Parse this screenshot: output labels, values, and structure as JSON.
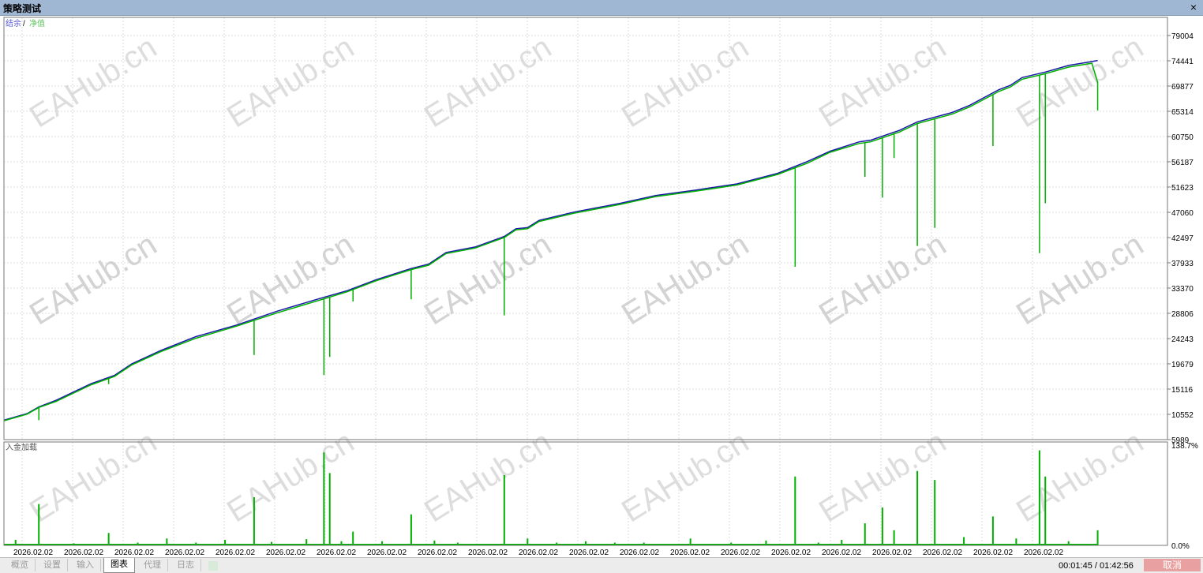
{
  "window": {
    "title": "策略测试",
    "close_label": "×"
  },
  "colors": {
    "balance": "#1a1aa6",
    "equity": "#00b000",
    "grid": "#dcdcdc",
    "watermark": "#cfcfcf",
    "axis_text": "#000000",
    "cancel_bg": "#e9a0a0"
  },
  "legend": {
    "balance": "结余",
    "separator": "/",
    "equity": "净值"
  },
  "lower_panel": {
    "title": "入金加载"
  },
  "watermark": "EAHub.cn",
  "tabs": [
    {
      "label": "概览",
      "active": false
    },
    {
      "label": "设置",
      "active": false
    },
    {
      "label": "输入",
      "active": false
    },
    {
      "label": "图表",
      "active": true
    },
    {
      "label": "代理",
      "active": false
    },
    {
      "label": "日志",
      "active": false
    }
  ],
  "status": {
    "timer": "00:01:45 / 01:42:56",
    "cancel_label": "取消"
  },
  "chart_data": [
    {
      "type": "line",
      "title": "",
      "y_ticks": [
        "79004",
        "74441",
        "69877",
        "65314",
        "60750",
        "56187",
        "51623",
        "47060",
        "42497",
        "37933",
        "33370",
        "28806",
        "24243",
        "19679",
        "15116",
        "10552",
        "5989"
      ],
      "ylim": [
        5989,
        81000
      ],
      "x_ticks": [
        "2026.02.02",
        "2026.02.02",
        "2026.02.02",
        "2026.02.02",
        "2026.02.02",
        "2026.02.02",
        "2026.02.02",
        "2026.02.02",
        "2026.02.02",
        "2026.02.02",
        "2026.02.02",
        "2026.02.02",
        "2026.02.02",
        "2026.02.02",
        "2026.02.02",
        "2026.02.02",
        "2026.02.02",
        "2026.02.02",
        "2026.02.02",
        "2026.02.02",
        "2026.02.02"
      ],
      "grid": true,
      "series": [
        {
          "name": "结余",
          "points": [
            [
              0,
              9500
            ],
            [
              4,
              10700
            ],
            [
              6,
              11900
            ],
            [
              9,
              13100
            ],
            [
              12,
              14600
            ],
            [
              15,
              16100
            ],
            [
              19,
              17600
            ],
            [
              22,
              19700
            ],
            [
              27,
              22100
            ],
            [
              33,
              24600
            ],
            [
              40,
              26700
            ],
            [
              47,
              29200
            ],
            [
              54,
              31400
            ],
            [
              59,
              32900
            ],
            [
              64,
              34900
            ],
            [
              70,
              36900
            ],
            [
              73,
              37700
            ],
            [
              76,
              39800
            ],
            [
              81,
              40800
            ],
            [
              86,
              42700
            ],
            [
              88,
              44100
            ],
            [
              90,
              44300
            ],
            [
              92,
              45600
            ],
            [
              94,
              46100
            ],
            [
              98,
              47100
            ],
            [
              106,
              48700
            ],
            [
              112,
              50100
            ],
            [
              119,
              51100
            ],
            [
              126,
              52200
            ],
            [
              133,
              54100
            ],
            [
              138,
              56200
            ],
            [
              142,
              58100
            ],
            [
              147,
              59800
            ],
            [
              149,
              60100
            ],
            [
              154,
              61900
            ],
            [
              157,
              63400
            ],
            [
              163,
              65100
            ],
            [
              166,
              66400
            ],
            [
              171,
              69200
            ],
            [
              173,
              70000
            ],
            [
              175,
              71400
            ],
            [
              179,
              72400
            ],
            [
              183,
              73600
            ],
            [
              187,
              74300
            ],
            [
              188,
              74500
            ]
          ]
        },
        {
          "name": "净值",
          "points": [
            [
              0,
              9400
            ],
            [
              4,
              10600
            ],
            [
              6,
              11800
            ],
            [
              9,
              12900
            ],
            [
              12,
              14400
            ],
            [
              15,
              15900
            ],
            [
              19,
              17400
            ],
            [
              22,
              19500
            ],
            [
              27,
              21900
            ],
            [
              33,
              24300
            ],
            [
              40,
              26500
            ],
            [
              47,
              28900
            ],
            [
              54,
              31100
            ],
            [
              59,
              32700
            ],
            [
              64,
              34700
            ],
            [
              70,
              36700
            ],
            [
              73,
              37500
            ],
            [
              76,
              39600
            ],
            [
              81,
              40600
            ],
            [
              86,
              42500
            ],
            [
              88,
              43900
            ],
            [
              90,
              44100
            ],
            [
              92,
              45400
            ],
            [
              94,
              45900
            ],
            [
              98,
              46900
            ],
            [
              106,
              48500
            ],
            [
              112,
              49900
            ],
            [
              119,
              50900
            ],
            [
              126,
              52000
            ],
            [
              133,
              53900
            ],
            [
              138,
              55900
            ],
            [
              142,
              57900
            ],
            [
              147,
              59500
            ],
            [
              149,
              59800
            ],
            [
              154,
              61600
            ],
            [
              157,
              63100
            ],
            [
              163,
              64800
            ],
            [
              166,
              66100
            ],
            [
              171,
              68900
            ],
            [
              173,
              69700
            ],
            [
              175,
              71100
            ],
            [
              179,
              72100
            ],
            [
              183,
              73300
            ],
            [
              187,
              74000
            ],
            [
              188,
              70500
            ]
          ]
        }
      ],
      "x_range": [
        0,
        200
      ]
    },
    {
      "type": "bar",
      "title": "入金加载",
      "y_ticks": [
        "138.7%",
        "0.0%"
      ],
      "ylim": [
        0,
        138.7
      ],
      "values": [
        [
          2,
          8
        ],
        [
          6,
          60
        ],
        [
          12,
          3
        ],
        [
          18,
          18
        ],
        [
          23,
          4
        ],
        [
          28,
          10
        ],
        [
          33,
          4
        ],
        [
          38,
          8
        ],
        [
          43,
          70
        ],
        [
          46,
          5
        ],
        [
          52,
          9
        ],
        [
          55,
          135
        ],
        [
          56,
          105
        ],
        [
          58,
          6
        ],
        [
          60,
          20
        ],
        [
          65,
          6
        ],
        [
          70,
          45
        ],
        [
          74,
          7
        ],
        [
          78,
          4
        ],
        [
          86,
          102
        ],
        [
          90,
          10
        ],
        [
          95,
          4
        ],
        [
          100,
          6
        ],
        [
          105,
          4
        ],
        [
          110,
          4
        ],
        [
          118,
          10
        ],
        [
          125,
          4
        ],
        [
          131,
          7
        ],
        [
          136,
          100
        ],
        [
          140,
          4
        ],
        [
          144,
          8
        ],
        [
          148,
          32
        ],
        [
          151,
          55
        ],
        [
          153,
          22
        ],
        [
          157,
          108
        ],
        [
          160,
          95
        ],
        [
          165,
          12
        ],
        [
          170,
          42
        ],
        [
          174,
          10
        ],
        [
          178,
          138
        ],
        [
          179,
          100
        ],
        [
          183,
          6
        ],
        [
          188,
          22
        ]
      ],
      "x_range": [
        0,
        200
      ]
    }
  ]
}
